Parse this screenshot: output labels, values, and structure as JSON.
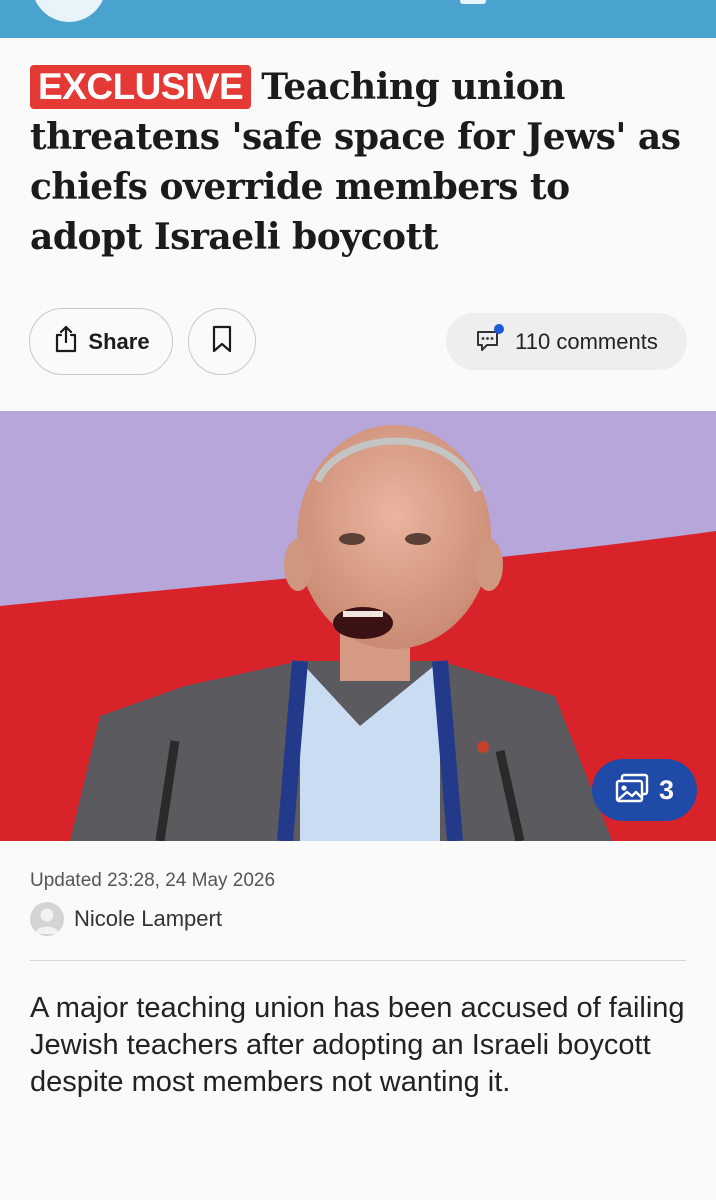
{
  "article": {
    "badge": "EXCLUSIVE",
    "headline": "Teaching union threatens 'safe space for Jews' as chiefs override members to adopt Israeli boycott",
    "updated": "Updated 23:28, 24 May 2026",
    "author": "Nicole Lampert",
    "lede": "A major teaching union has been accused of failing Jewish teachers after adopting an Israeli boycott despite most members not wanting it."
  },
  "actions": {
    "share_label": "Share",
    "comments_label": "110 comments"
  },
  "gallery": {
    "count": "3"
  },
  "icons": {
    "share": "share-icon",
    "bookmark": "bookmark-icon",
    "comments": "comment-icon",
    "gallery": "gallery-icon",
    "avatar": "user-avatar-icon"
  },
  "colors": {
    "topbar": "#4aa3cf",
    "badge": "#e53935",
    "gallery_badge": "#1f4aa8",
    "comment_dot": "#1f5bd8"
  }
}
